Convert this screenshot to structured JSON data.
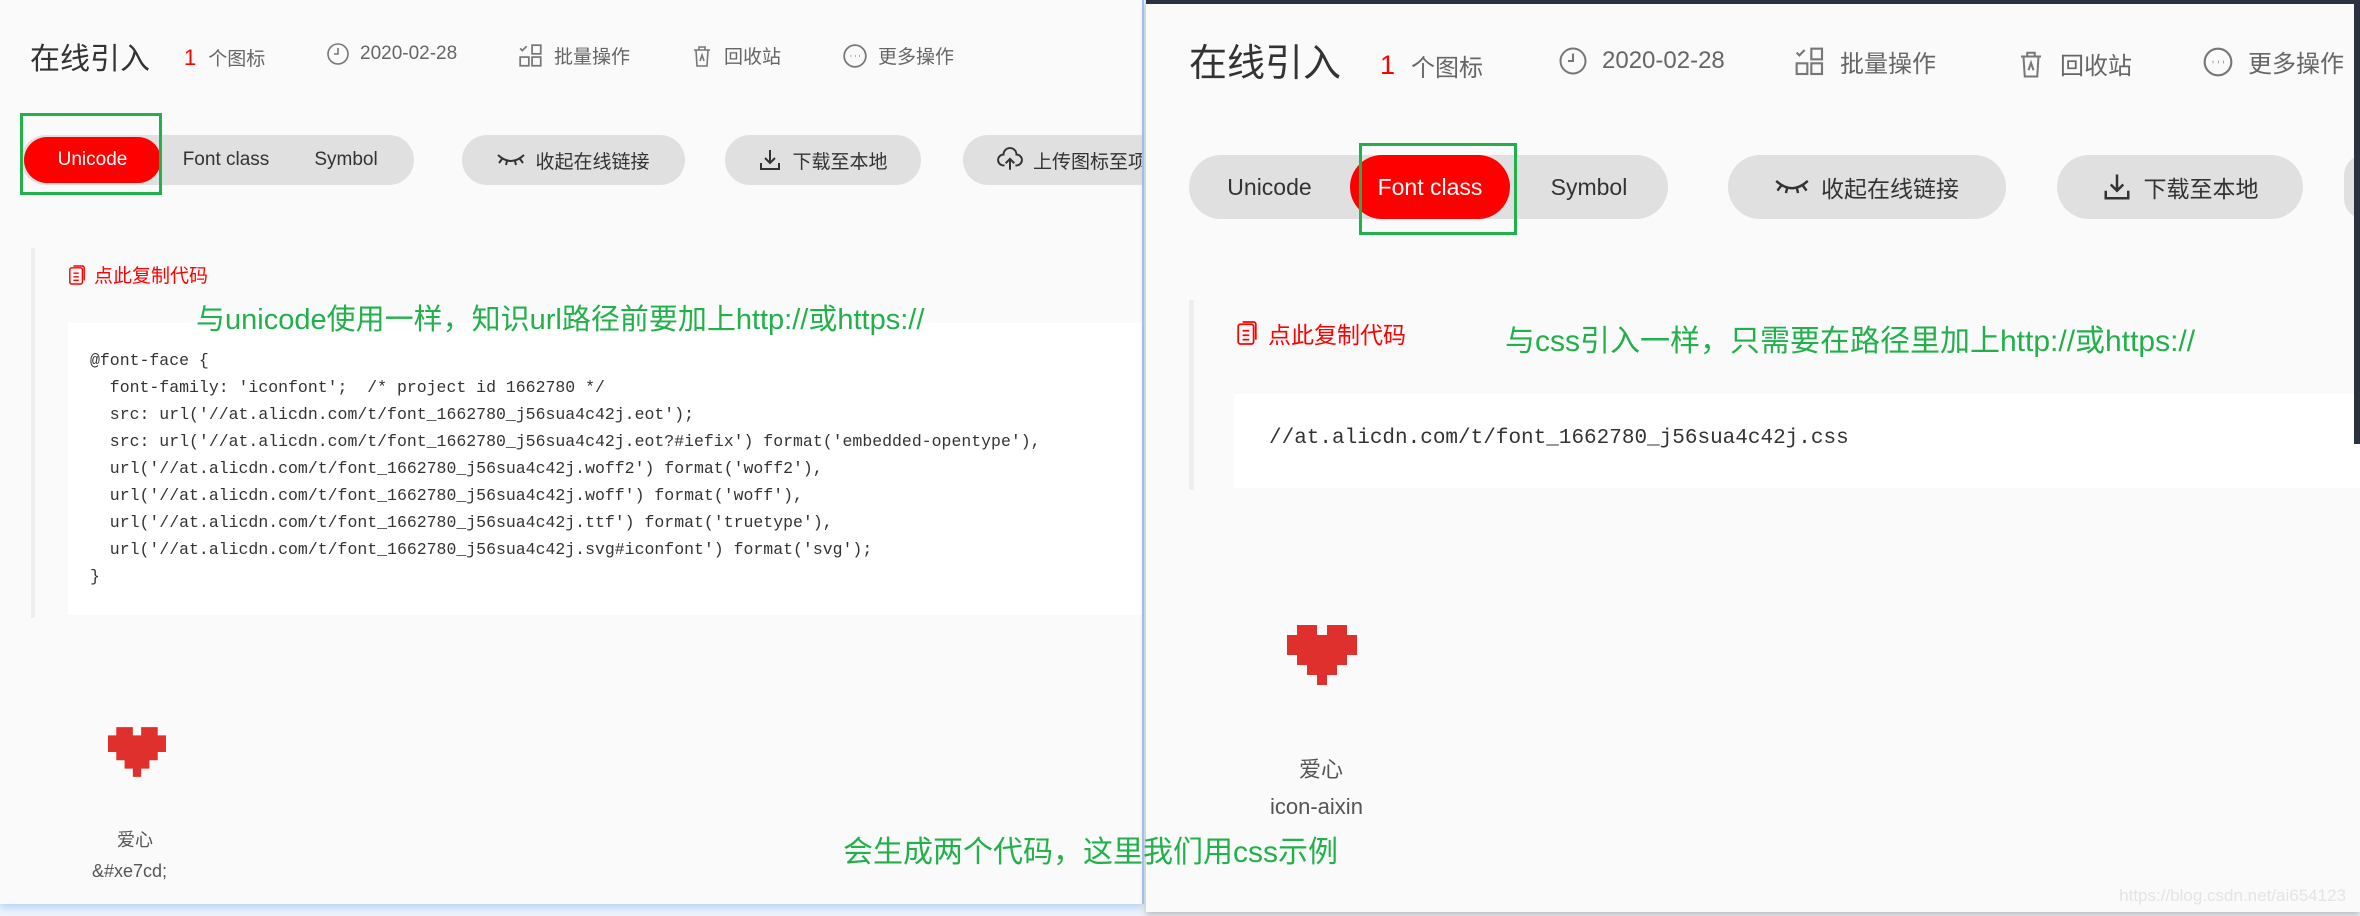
{
  "left": {
    "title": "在线引入",
    "icon_count": "1",
    "icon_count_label": "个图标",
    "date": "2020-02-28",
    "batch": "批量操作",
    "recycle": "回收站",
    "more": "更多操作",
    "tabs": [
      "Unicode",
      "Font class",
      "Symbol"
    ],
    "active_tab": "Unicode",
    "collapse_link": "收起在线链接",
    "download": "下载至本地",
    "upload": "上传图标至项",
    "copy_code": "点此复制代码",
    "code_lines": [
      "@font-face {",
      "  font-family: 'iconfont';  /* project id 1662780 */",
      "  src: url('//at.alicdn.com/t/font_1662780_j56sua4c42j.eot');",
      "  src: url('//at.alicdn.com/t/font_1662780_j56sua4c42j.eot?#iefix') format('embedded-opentype'),",
      "  url('//at.alicdn.com/t/font_1662780_j56sua4c42j.woff2') format('woff2'),",
      "  url('//at.alicdn.com/t/font_1662780_j56sua4c42j.woff') format('woff'),",
      "  url('//at.alicdn.com/t/font_1662780_j56sua4c42j.ttf') format('truetype'),",
      "  url('//at.alicdn.com/t/font_1662780_j56sua4c42j.svg#iconfont') format('svg');",
      "}"
    ],
    "icon_name": "爱心",
    "icon_code": "&#xe7cd;"
  },
  "right": {
    "title": "在线引入",
    "icon_count": "1",
    "icon_count_label": "个图标",
    "date": "2020-02-28",
    "batch": "批量操作",
    "recycle": "回收站",
    "more": "更多操作",
    "tabs": [
      "Unicode",
      "Font class",
      "Symbol"
    ],
    "active_tab": "Font class",
    "collapse_link": "收起在线链接",
    "download": "下载至本地",
    "copy_code": "点此复制代码",
    "code": "//at.alicdn.com/t/font_1662780_j56sua4c42j.css",
    "icon_name": "爱心",
    "icon_class": "icon-aixin"
  },
  "annotations": {
    "unicode_note": "与unicode使用一样，知识url路径前要加上http://或https://",
    "css_note": "与css引入一样，只需要在路径里加上http://或https://",
    "bottom_note": "会生成两个代码，这里我们用css示例"
  },
  "watermark": "https://blog.csdn.net/ai654123",
  "colors": {
    "accent": "#ff0000",
    "annotation": "#22b04b",
    "heart": "#e0302e"
  }
}
